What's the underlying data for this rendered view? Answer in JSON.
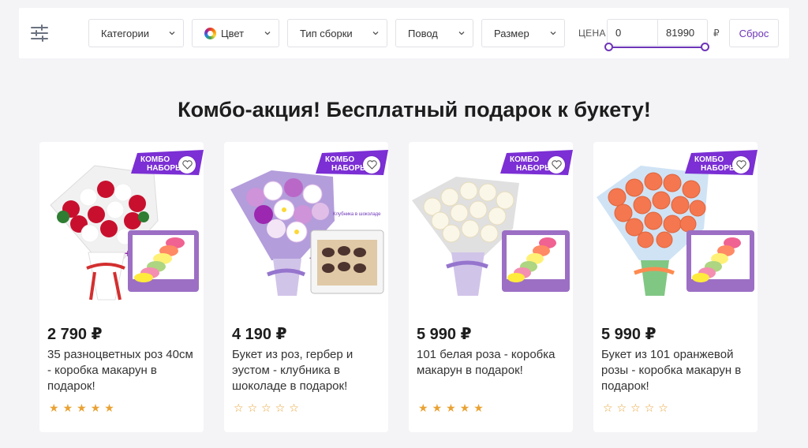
{
  "filters": {
    "settings_icon": "sliders-icon",
    "buttons": [
      {
        "label": "Категории"
      },
      {
        "label": "Цвет"
      },
      {
        "label": "Тип сборки"
      },
      {
        "label": "Повод"
      },
      {
        "label": "Размер"
      }
    ],
    "price_label": "ЦЕНА",
    "price_from": "0",
    "price_to": "81990",
    "currency": "₽",
    "reset_label": "Сброс",
    "accent_color": "#6d35b8"
  },
  "section": {
    "title": "Комбо-акция! Бесплатный подарок к букету!"
  },
  "products": [
    {
      "badge": "КОМБО НАБОРЫ",
      "price": "2 790 ₽",
      "title": "35 разноцветных роз 40см - коробка макарун в подарок!",
      "rating_filled": 5,
      "rating_max": 5,
      "flower": "red-white-roses",
      "gift": "macarons"
    },
    {
      "badge": "КОМБО НАБОРЫ",
      "price": "4 190 ₽",
      "title": "Букет из роз, гербер и эустом - клубника в шоколаде в подарок!",
      "rating_filled": 0,
      "rating_max": 5,
      "flower": "purple-mix",
      "gift": "strawberries",
      "gift_caption": "Клубника в шоколаде"
    },
    {
      "badge": "КОМБО НАБОРЫ",
      "price": "5 990 ₽",
      "title": "101 белая роза - коробка макарун в подарок!",
      "rating_filled": 5,
      "rating_max": 5,
      "flower": "white-roses",
      "gift": "macarons"
    },
    {
      "badge": "КОМБО НАБОРЫ",
      "price": "5 990 ₽",
      "title": "Букет из 101 оранжевой розы - коробка макарун в подарок!",
      "rating_filled": 0,
      "rating_max": 5,
      "flower": "orange-roses",
      "gift": "macarons"
    }
  ]
}
